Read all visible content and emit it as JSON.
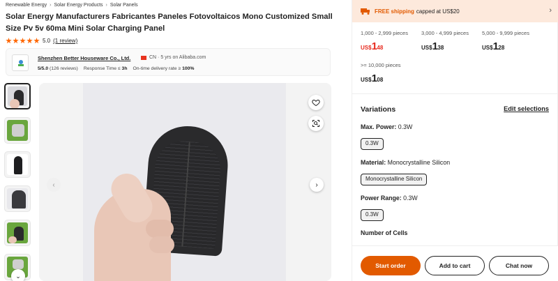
{
  "breadcrumb": [
    "Renewable Energy",
    "Solar Energy Products",
    "Solar Panels"
  ],
  "product": {
    "title": "Solar Energy Manufacturers Fabricantes Paneles Fotovoltaicos Mono Customized Small Size Pv 5v 60ma Mini Solar Charging Panel",
    "rating": "5.0",
    "stars": 5,
    "reviews_link": "(1 review)"
  },
  "supplier": {
    "name": "Shenzhen Better Houseware Co., Ltd.",
    "country_years": "CN · 5 yrs on Alibaba.com",
    "score": "5/5.0",
    "reviews": "(126 reviews)",
    "response_label": "Response Time ≤",
    "response_value": "3h",
    "ontime_label": "On-time delivery rate ≥",
    "ontime_value": "100%"
  },
  "shipping": {
    "free": "FREE shipping",
    "cap": "capped at US$20"
  },
  "tiers": [
    {
      "range": "1,000 - 2,999 pieces",
      "currency": "US$",
      "whole": "1",
      "cents": "48"
    },
    {
      "range": "3,000 - 4,999 pieces",
      "currency": "US$",
      "whole": "1",
      "cents": "38"
    },
    {
      "range": "5,000 - 9,999 pieces",
      "currency": "US$",
      "whole": "1",
      "cents": "28"
    },
    {
      "range": ">= 10,000 pieces",
      "currency": "US$",
      "whole": "1",
      "cents": "08"
    }
  ],
  "variations": {
    "title": "Variations",
    "edit": "Edit selections",
    "max_power_label": "Max. Power:",
    "max_power_value": "0.3W",
    "max_power_chip": "0.3W",
    "material_label": "Material:",
    "material_value": "Monocrystalline Silicon",
    "material_chip": "Monocrystalline Silicon",
    "power_range_label": "Power Range:",
    "power_range_value": "0.3W",
    "power_range_chip": "0.3W",
    "cells_label": "Number of Cells"
  },
  "actions": {
    "order": "Start order",
    "cart": "Add to cart",
    "chat": "Chat now"
  },
  "colors": {
    "accent": "#e25a00",
    "price_red": "#e82c20",
    "ship_bg": "#fde9dc"
  }
}
